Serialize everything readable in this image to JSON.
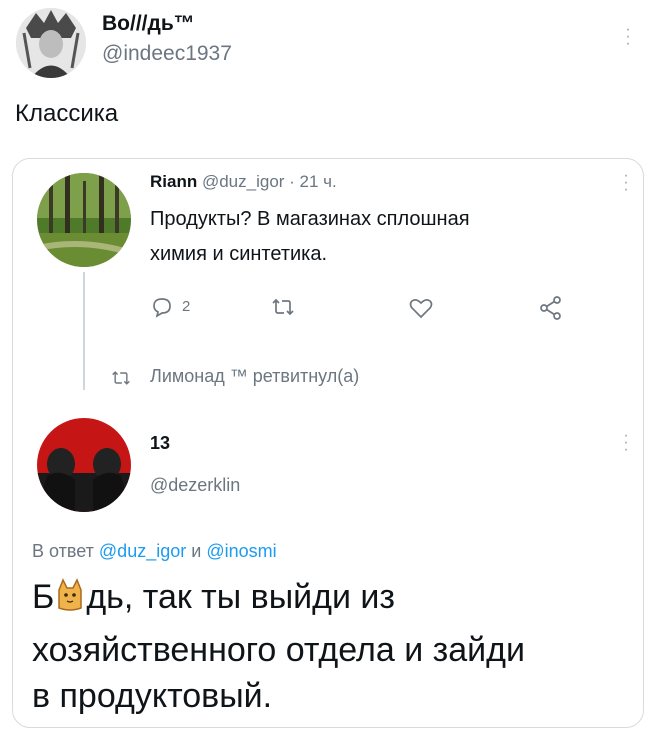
{
  "main_tweet": {
    "display_name": "Во///дь™",
    "handle": "@indeec1937",
    "text": "Классика"
  },
  "quoted_thread": {
    "first_tweet": {
      "display_name": "Riann",
      "meta": "@duz_igor · 21 ч.",
      "text_line1": "Продукты? В магазинах сплошная",
      "text_line2": "химия и синтетика.",
      "actions": {
        "reply_count": "2"
      }
    },
    "retweet_notice": "Лимонад ™ ретвитнул(а)",
    "second_tweet": {
      "display_name": "13",
      "handle": "@dezerklin",
      "reply_prefix": "В ответ",
      "reply_user1": "@duz_igor",
      "reply_and": "и",
      "reply_user2": "@inosmi",
      "text_line1_a": "Б",
      "text_line1_b": "дь, так ты выйди из",
      "text_line2": "хозяйственного отдела и зайди",
      "text_line3": "в продуктовый."
    }
  },
  "colors": {
    "link": "#1d9bf0",
    "muted": "#6b7681",
    "border": "#d6dbe0"
  }
}
